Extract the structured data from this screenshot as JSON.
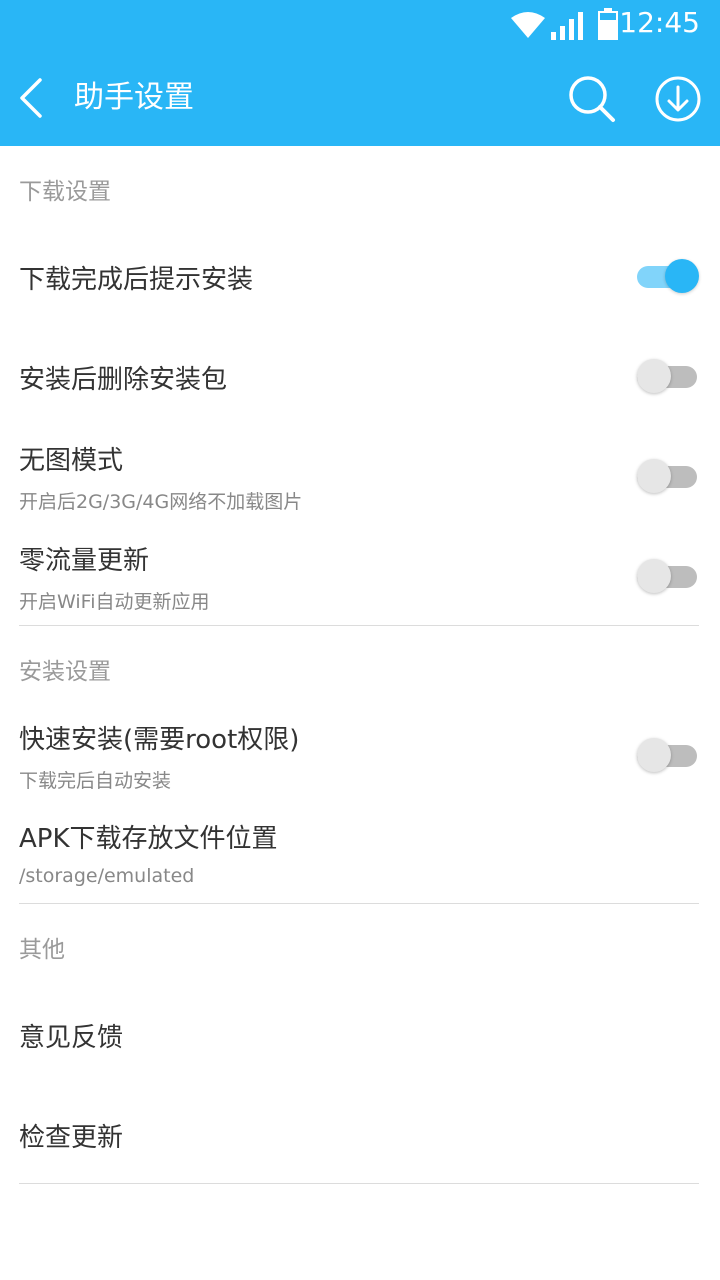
{
  "status_bar": {
    "time": "12:45"
  },
  "toolbar": {
    "title": "助手设置",
    "back_icon": "chevron-left-icon",
    "search_icon": "search-icon",
    "download_icon": "download-icon",
    "background_color": "#29b6f6"
  },
  "sections": {
    "download": {
      "header": "下载设置",
      "items": [
        {
          "title": "下载完成后提示安装",
          "enabled": true
        },
        {
          "title": "安装后删除安装包",
          "enabled": false
        },
        {
          "title": "无图模式",
          "subtitle": "开启后2G/3G/4G网络不加载图片",
          "enabled": false
        },
        {
          "title": "零流量更新",
          "subtitle": "开启WiFi自动更新应用",
          "enabled": false
        }
      ]
    },
    "install": {
      "header": "安装设置",
      "items": [
        {
          "title": "快速安装(需要root权限)",
          "subtitle": "下载完后自动安装",
          "enabled": false
        },
        {
          "title": "APK下载存放文件位置",
          "subtitle": "/storage/emulated"
        }
      ]
    },
    "other": {
      "header": "其他",
      "items": [
        {
          "title": "意见反馈"
        },
        {
          "title": "检查更新"
        }
      ]
    }
  },
  "colors": {
    "accent": "#29b6f6",
    "switch_on_track": "#81d4fa",
    "switch_off_track": "#bdbdbd"
  }
}
